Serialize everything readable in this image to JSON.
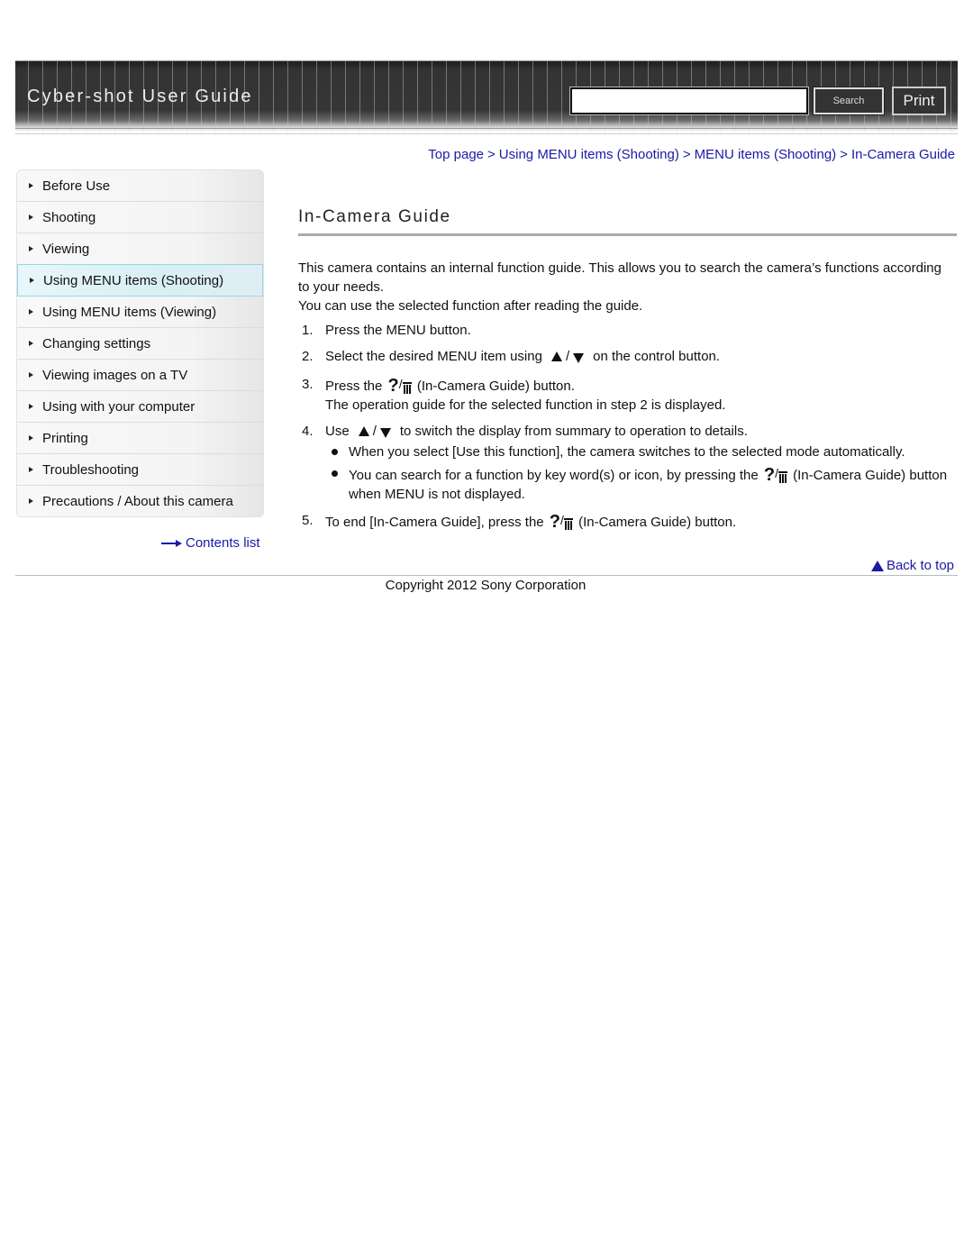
{
  "header": {
    "title": "Cyber-shot User Guide",
    "search_value": "",
    "search_button": "Search",
    "print_button": "Print"
  },
  "breadcrumb": [
    {
      "label": "Top page"
    },
    {
      "label": "Using MENU items (Shooting)"
    },
    {
      "label": "MENU items (Shooting)"
    },
    {
      "label": "In-Camera Guide"
    }
  ],
  "breadcrumb_separator": ">",
  "sidebar": {
    "items": [
      {
        "label": "Before Use"
      },
      {
        "label": "Shooting"
      },
      {
        "label": "Viewing"
      },
      {
        "label": "Using MENU items (Shooting)",
        "active": true
      },
      {
        "label": "Using MENU items (Viewing)"
      },
      {
        "label": "Changing settings"
      },
      {
        "label": "Viewing images on a TV"
      },
      {
        "label": "Using with your computer"
      },
      {
        "label": "Printing"
      },
      {
        "label": "Troubleshooting"
      },
      {
        "label": "Precautions / About this camera"
      }
    ],
    "contents_link": "Contents list"
  },
  "main": {
    "title": "In-Camera Guide",
    "intro_1": "This camera contains an internal function guide. This allows you to search the camera’s functions according to your needs.",
    "intro_2": "You can use the selected function after reading the guide.",
    "steps": [
      {
        "num": "1.",
        "text": "Press the MENU button."
      },
      {
        "num": "2.",
        "text_before": "Select the desired MENU item using",
        "text_after": "on the control button."
      },
      {
        "num": "3.",
        "text_before": "Press the",
        "text_after": "(In-Camera Guide) button.",
        "sub": "The operation guide for the selected function in step 2 is displayed."
      },
      {
        "num": "4.",
        "text_before": "Use",
        "text_after": "to switch the display from summary to operation to details.",
        "bullets": [
          {
            "text": "When you select [Use this function], the camera switches to the selected mode automatically."
          },
          {
            "text_before": "You can search for a function by key word(s) or icon, by pressing the",
            "text_after": "(In-Camera Guide) button when MENU is not displayed."
          }
        ]
      },
      {
        "num": "5.",
        "text_before": "To end [In-Camera Guide], press the",
        "text_after": "(In-Camera Guide) button."
      }
    ],
    "slash": "/",
    "guide_icon_q": "?"
  },
  "footer": {
    "back_to_top": "Back to top",
    "copyright": "Copyright 2012 Sony Corporation"
  }
}
